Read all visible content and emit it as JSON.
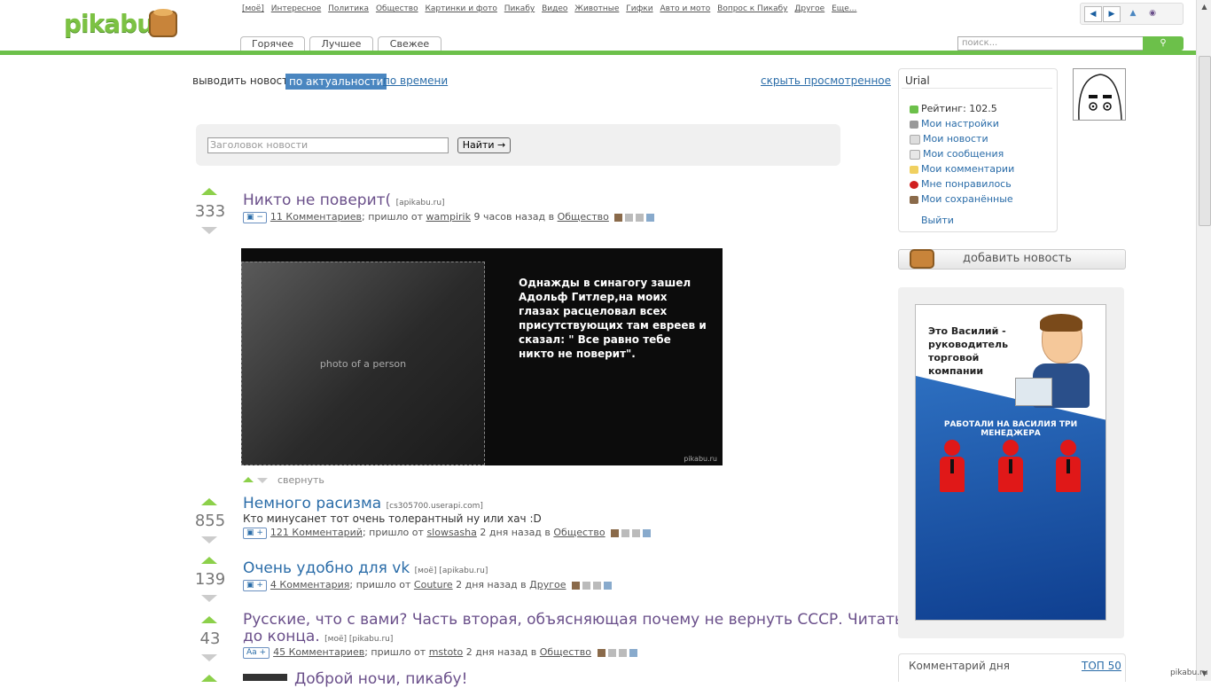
{
  "site": {
    "logo_text": "pikabu",
    "accent_color": "#6cc04a",
    "link_color": "#2a6ca8"
  },
  "top_nav": [
    "[моё]",
    "Интересное",
    "Политика",
    "Общество",
    "Картинки и фото",
    "Пикабу",
    "Видео",
    "Животные",
    "Гифки",
    "Авто и мото",
    "Вопрос к Пикабу",
    "Другое",
    "Еще..."
  ],
  "tabs": [
    "Горячее",
    "Лучшее",
    "Свежее"
  ],
  "header_search": {
    "placeholder": "поиск..."
  },
  "nav_icons": [
    "arrow-left-icon",
    "arrow-right-icon",
    "arrow-up-icon",
    "eye-icon"
  ],
  "sort": {
    "label": "выводить новости",
    "active": "по актуальности",
    "other": "по времени",
    "hide_viewed": "скрыть просмотренное"
  },
  "title_search": {
    "placeholder": "Заголовок новости",
    "button": "Найти →"
  },
  "posts": [
    {
      "score": "333",
      "title": "Никто не поверит(",
      "source": "[apikabu.ru]",
      "badge": "▣ −",
      "comments": "11 Комментариев",
      "meta_from": "; пришло от",
      "author": "wampirik",
      "time": "9 часов назад в",
      "category": "Общество",
      "image": {
        "photo_placeholder": "photo of a person",
        "text": "Однажды в синагогу зашел Адольф Гитлер,на моих глазах расцеловал всех присутствующих там  евреев и сказал: \" Все равно тебе никто не поверит\".",
        "watermark": "pikabu.ru"
      },
      "collapse": "свернуть"
    },
    {
      "score": "855",
      "title": "Немного расизма",
      "source": "[cs305700.userapi.com]",
      "description": "Кто минусанет тот очень толерантный ну или хач :D",
      "badge": "▣ +",
      "comments": "121 Комментарий",
      "meta_from": "; пришло от",
      "author": "slowsasha",
      "time": "2 дня назад в",
      "category": "Общество"
    },
    {
      "score": "139",
      "title": "Очень удобно для vk",
      "source": "[моё] [apikabu.ru]",
      "badge": "▣ +",
      "comments": "4 Комментария",
      "meta_from": "; пришло от",
      "author": "Couture",
      "time": "2 дня назад в",
      "category": "Другое"
    },
    {
      "score": "43",
      "title_line1": "Русские, что с вами? Часть вторая, объясняющая почему не вернуть СССР. Читать",
      "title_line2": "до конца.",
      "source": "[моё] [pikabu.ru]",
      "badge": "Aa +",
      "comments": "45 Комментариев",
      "meta_from": "; пришло от",
      "author": "mstoto",
      "time": "2 дня назад в",
      "category": "Общество"
    }
  ],
  "next_post_partial_title": "Доброй ночи, пикабу!",
  "user": {
    "name": "Urial",
    "rating": "Рейтинг: 102.5",
    "menu": [
      "Мои настройки",
      "Мои новости",
      "Мои сообщения",
      "Мои комментарии",
      "Мне понравилось",
      "Мои сохранённые"
    ],
    "logout": "Выйти"
  },
  "add_news": "добавить новость",
  "ad": {
    "text1": "Это Василий - руководитель торговой компании",
    "text2": "РАБОТАЛИ НА ВАСИЛИЯ ТРИ МЕНЕДЖЕРА"
  },
  "comment_of_day": {
    "label": "Комментарий дня",
    "top": "ТОП 50"
  },
  "watermark": "pikabu.ru"
}
